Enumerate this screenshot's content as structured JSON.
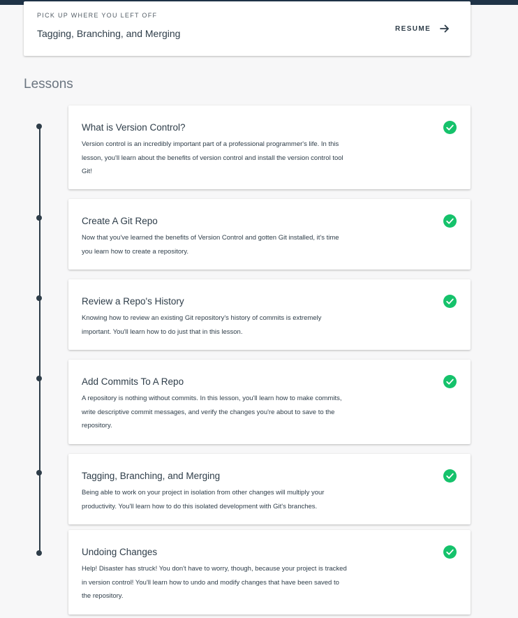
{
  "resume": {
    "eyebrow": "PICK UP WHERE YOU LEFT OFF",
    "title": "Tagging, Branching, and Merging",
    "button_label": "RESUME"
  },
  "lessons_heading": "Lessons",
  "lessons": [
    {
      "title": "What is Version Control?",
      "description": "Version control is an incredibly important part of a professional programmer's life. In this lesson, you'll learn about the benefits of version control and install the version control tool Git!",
      "completed": true
    },
    {
      "title": "Create A Git Repo",
      "description": "Now that you've learned the benefits of Version Control and gotten Git installed, it's time you learn how to create a repository.",
      "completed": true
    },
    {
      "title": "Review a Repo's History",
      "description": "Knowing how to review an existing Git repository's history of commits is extremely important. You'll learn how to do just that in this lesson.",
      "completed": true
    },
    {
      "title": "Add Commits To A Repo",
      "description": "A repository is nothing without commits. In this lesson, you'll learn how to make commits, write descriptive commit messages, and verify the changes you're about to save to the repository.",
      "completed": true
    },
    {
      "title": "Tagging, Branching, and Merging",
      "description": "Being able to work on your project in isolation from other changes will multiply your productivity. You'll learn how to do this isolated development with Git's branches.",
      "completed": true
    },
    {
      "title": "Undoing Changes",
      "description": "Help! Disaster has struck! You don't have to worry, though, because your project is tracked in version control! You'll learn how to undo and modify changes that have been saved to the repository.",
      "completed": true
    }
  ],
  "icons": {
    "resume": "arrow-right-icon",
    "completed": "check-circle-icon"
  },
  "colors": {
    "topbar": "#1f3347",
    "completed": "#02b3e4",
    "check_green": "#15c26b",
    "text": "#2e3d49"
  }
}
